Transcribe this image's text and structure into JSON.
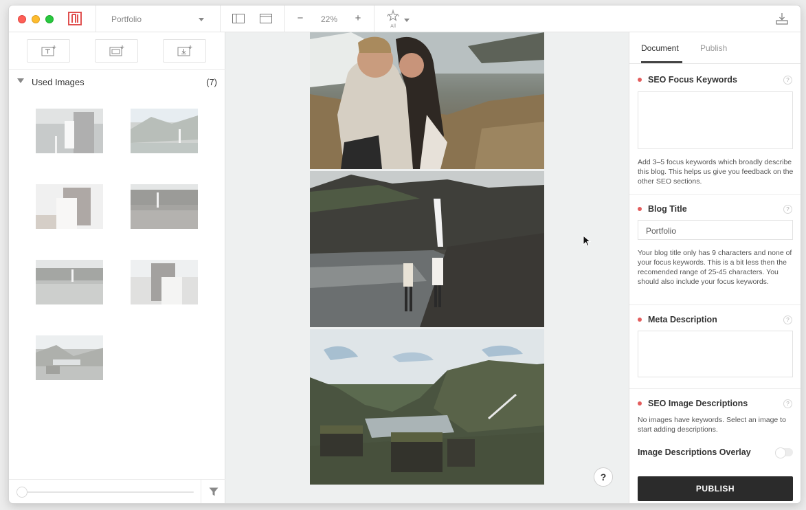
{
  "toolbar": {
    "document_name": "Portfolio",
    "zoom": "22%",
    "zoom_out": "−",
    "zoom_in": "+",
    "filter_label": "All"
  },
  "sidebar": {
    "used_images_label": "Used Images",
    "used_images_count": "(7)",
    "thumbnails": [
      {
        "name": "thumbnail-couple-waterfall"
      },
      {
        "name": "thumbnail-mountains-waterfall"
      },
      {
        "name": "thumbnail-couple-embrace"
      },
      {
        "name": "thumbnail-cliff-waterfall"
      },
      {
        "name": "thumbnail-waterfall-walk"
      },
      {
        "name": "thumbnail-couple-kiss"
      },
      {
        "name": "thumbnail-lake-village"
      }
    ]
  },
  "canvas": {
    "help_label": "?"
  },
  "panel": {
    "tabs": [
      "Document",
      "Publish"
    ],
    "active_tab": "Document",
    "seo_keywords": {
      "title": "SEO Focus Keywords",
      "value": "",
      "hint": "Add 3–5 focus keywords which broadly describe this blog. This helps us give you feedback on the other SEO sections."
    },
    "blog_title": {
      "title": "Blog Title",
      "value": "Portfolio",
      "hint": "Your blog title only has 9 characters and none of your focus keywords. This is a bit less then the recomended range of 25-45 characters. You should also include your focus keywords."
    },
    "meta_description": {
      "title": "Meta Description",
      "value": ""
    },
    "image_descriptions": {
      "title": "SEO Image Descriptions",
      "hint": "No images have keywords. Select an image to start adding descriptions."
    },
    "overlay": {
      "label": "Image Descriptions Overlay",
      "enabled": false
    },
    "help_label": "?",
    "publish_label": "PUBLISH"
  },
  "colors": {
    "status_dot": "#e35d5d",
    "publish_bg": "#2b2b2b",
    "logo": "#e0504f"
  }
}
